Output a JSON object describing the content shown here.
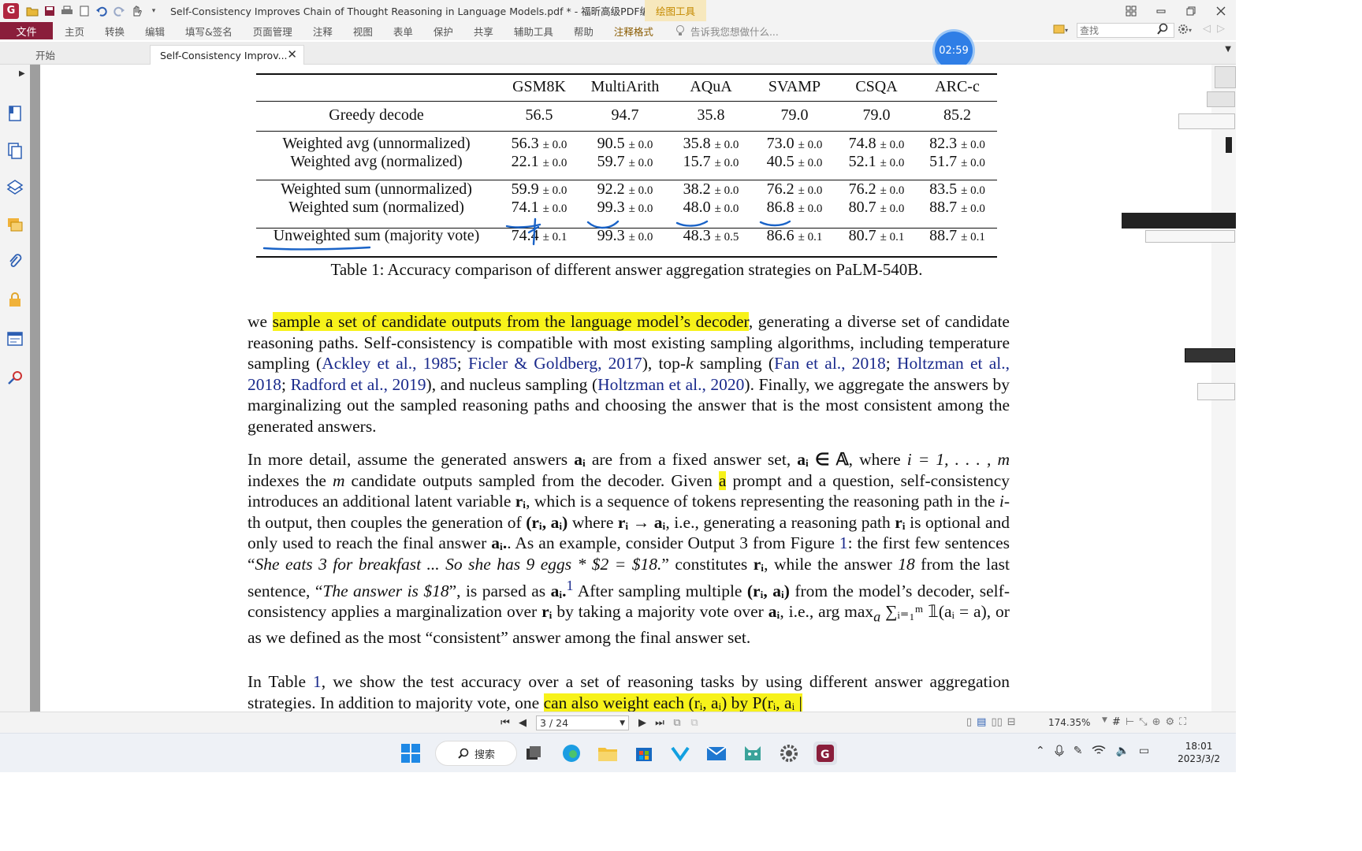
{
  "app": {
    "logo_letter": "G",
    "title": "Self-Consistency Improves Chain of Thought Reasoning in Language Models.pdf * - 福昕高级PDF编辑器",
    "context_tool": "绘图工具"
  },
  "menu": {
    "file": "文件",
    "items": [
      "主页",
      "转换",
      "编辑",
      "填写&签名",
      "页面管理",
      "注释",
      "视图",
      "表单",
      "保护",
      "共享",
      "辅助工具",
      "帮助"
    ],
    "context_item": "注释格式",
    "tell_me": "告诉我您想做什么...",
    "search_placeholder": "查找"
  },
  "tabs": {
    "home": "开始",
    "active": "Self-Consistency Improv...",
    "close": "✕"
  },
  "timer": "02:59",
  "table": {
    "headers": [
      "",
      "GSM8K",
      "MultiArith",
      "AQuA",
      "SVAMP",
      "CSQA",
      "ARC-c"
    ],
    "greedy": {
      "label": "Greedy decode",
      "values": [
        "56.5",
        "94.7",
        "35.8",
        "79.0",
        "79.0",
        "85.2"
      ]
    },
    "group1": [
      {
        "label": "Weighted avg (unnormalized)",
        "values": [
          "56.3",
          "90.5",
          "35.8",
          "73.0",
          "74.8",
          "82.3"
        ],
        "pm": [
          "± 0.0",
          "± 0.0",
          "± 0.0",
          "± 0.0",
          "± 0.0",
          "± 0.0"
        ]
      },
      {
        "label": "Weighted avg (normalized)",
        "values": [
          "22.1",
          "59.7",
          "15.7",
          "40.5",
          "52.1",
          "51.7"
        ],
        "pm": [
          "± 0.0",
          "± 0.0",
          "± 0.0",
          "± 0.0",
          "± 0.0",
          "± 0.0"
        ]
      }
    ],
    "group2": [
      {
        "label": "Weighted sum (unnormalized)",
        "values": [
          "59.9",
          "92.2",
          "38.2",
          "76.2",
          "76.2",
          "83.5"
        ],
        "pm": [
          "± 0.0",
          "± 0.0",
          "± 0.0",
          "± 0.0",
          "± 0.0",
          "± 0.0"
        ]
      },
      {
        "label": "Weighted sum (normalized)",
        "values": [
          "74.1",
          "99.3",
          "48.0",
          "86.8",
          "80.7",
          "88.7"
        ],
        "pm": [
          "± 0.0",
          "± 0.0",
          "± 0.0",
          "± 0.0",
          "± 0.0",
          "± 0.0"
        ]
      }
    ],
    "majority": {
      "label_a": "Unweighted sum",
      "label_b": " (majority vote)",
      "values": [
        "74.4",
        "99.3",
        "48.3",
        "86.6",
        "80.7",
        "88.7"
      ],
      "pm": [
        "± 0.1",
        "± 0.0",
        "± 0.5",
        "± 0.1",
        "± 0.1",
        "± 0.1"
      ]
    },
    "caption": "Table 1: Accuracy comparison of different answer aggregation strategies on PaLM-540B."
  },
  "paragraphs": {
    "p1": {
      "t1": "we ",
      "h1": "sample a set of candidate outputs from the language model’s decoder",
      "t2": ", generating a diverse set of candidate reasoning paths. Self-consistency is compatible with most existing sampling algorithms, including temperature sampling (",
      "c1": "Ackley et al., 1985",
      "t3": "; ",
      "c2": "Ficler & Goldberg, 2017",
      "t4": "), top-",
      "k": "k",
      "t5": " sampling (",
      "c3": "Fan et al., 2018",
      "t6": "; ",
      "c4": "Holtzman et al., 2018",
      "t7": "; ",
      "c5": "Radford et al., 2019",
      "t8": "), and nucleus sampling (",
      "c6": "Holtzman et al., 2020",
      "t9": "). Finally, we aggregate the answers by marginalizing out the sampled reasoning paths and choosing the answer that is the most consistent among the generated answers."
    },
    "p2": {
      "s1": "In more detail, assume the generated answers ",
      "s2": " are from a fixed answer set, ",
      "s3": ", where ",
      "s4": "i = 1, . . . , m",
      "s5": " indexes the ",
      "s6": "m",
      "s7": " candidate outputs sampled from the decoder. Given ",
      "hl": "a",
      "s8": " prompt and a question, self-consistency introduces an additional latent variable ",
      "s9": ", which is a sequence of tokens representing the reasoning path in the ",
      "s10": "i",
      "s11": "-th output, then couples the generation of ",
      "s12": " where ",
      "s13": ", i.e., generating a reasoning path ",
      "s14": " is optional and only used to reach the final answer ",
      "s15": ". As an example, consider Output 3 from Figure ",
      "fig": "1",
      "s16": ": the first few sentences “",
      "q1": "She eats 3 for breakfast ... So she has 9 eggs * $2 = $18.",
      "s17": "” constitutes ",
      "s18": ", while the answer ",
      "n18": "18",
      "s19": " from the last sentence, “",
      "q2": "The answer is $18",
      "s20": "”, is parsed as ",
      "fn": "1",
      "s21": " After sampling multiple ",
      "s22": " from the model’s decoder, self-consistency applies a marginalization over ",
      "s23": " by taking a majority vote over ",
      "s24": ", i.e., arg max",
      "s25": ",",
      "s26": " or as we defined as the most “consistent” answer among the final answer set.",
      "ai": "aᵢ",
      "ai_in": "aᵢ ∈ 𝔸",
      "ri": "rᵢ",
      "pair": "(rᵢ, aᵢ)",
      "arrow": "rᵢ → aᵢ",
      "aidot": "aᵢ.",
      "sum": "∑ᵢ₌₁ᵐ 𝟙(aᵢ = a)",
      "sub_a": "a"
    },
    "p3": {
      "t1": "In Table ",
      "ref": "1",
      "t2": ", we show the test accuracy over a set of reasoning tasks by using different answer aggregation strategies. In addition to majority vote, one ",
      "hl": "can also weight each (rᵢ, aᵢ) by P(rᵢ, aᵢ |"
    }
  },
  "status": {
    "page": "3 / 24",
    "zoom": "174.35%"
  },
  "taskbar": {
    "search": "搜索",
    "time": "18:01",
    "date": "2023/3/2"
  }
}
